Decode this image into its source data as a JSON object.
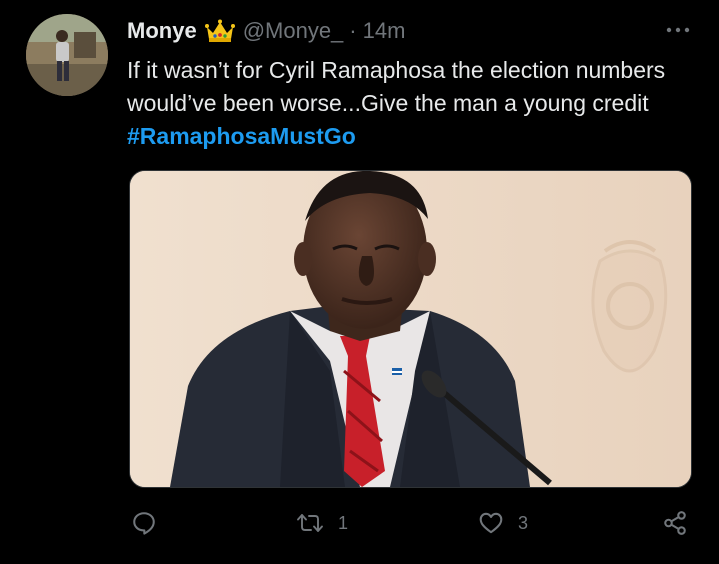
{
  "tweet": {
    "display_name": "Monye",
    "handle": "@Monye_",
    "separator": "·",
    "time": "14m",
    "text_before": "If it wasn’t for Cyril Ramaphosa the election numbers would’ve been worse...Give the man a young credit ",
    "hashtag": "#RamaphosaMustGo"
  },
  "actions": {
    "reply_count": "",
    "retweet_count": "1",
    "like_count": "3"
  },
  "icons": {
    "badge": "crown-icon",
    "more": "more-horizontal-icon",
    "reply": "reply-icon",
    "retweet": "retweet-icon",
    "like": "heart-icon",
    "share": "share-icon"
  },
  "colors": {
    "background": "#000000",
    "text": "#e7e9ea",
    "secondary": "#71767b",
    "hashtag": "#1d9bf0"
  }
}
